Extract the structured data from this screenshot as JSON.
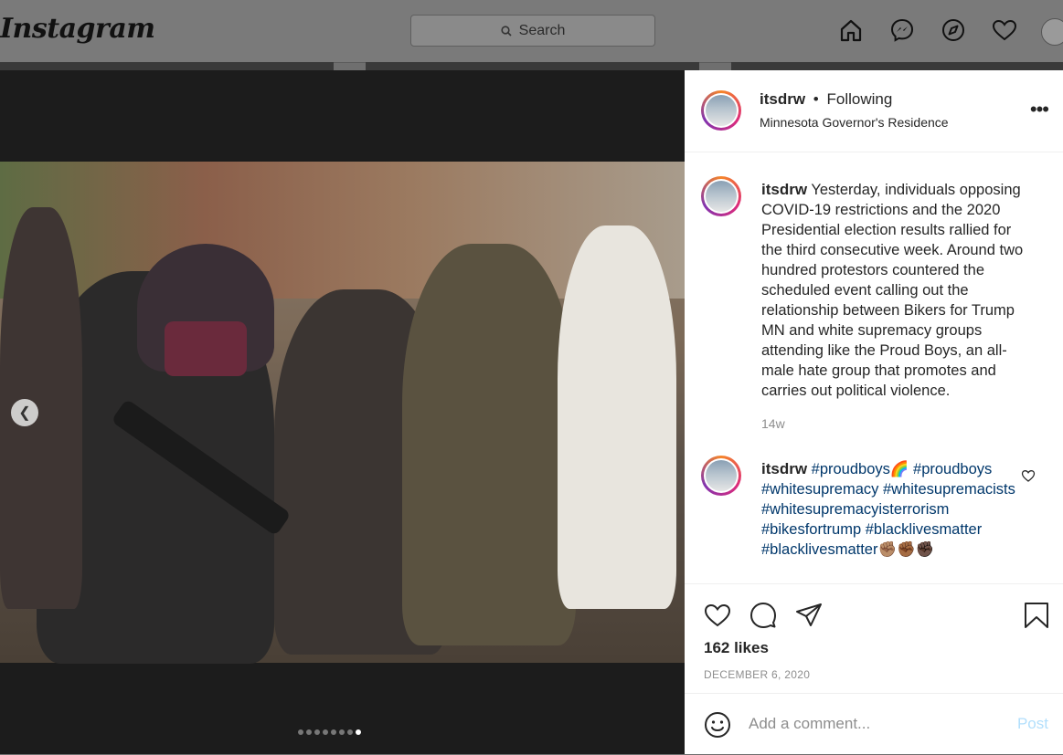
{
  "topnav": {
    "logo": "Instagram",
    "search_placeholder": "Search"
  },
  "post": {
    "username": "itsdrw",
    "separator": "•",
    "follow_status": "Following",
    "location": "Minnesota Governor's Residence",
    "caption": {
      "username": "itsdrw",
      "text": "Yesterday, individuals opposing COVID-19 restrictions and the 2020 Presidential election results rallied for the third consecutive week. Around two hundred protestors countered the scheduled event calling out the relationship between Bikers for Trump MN and white supremacy groups attending like the Proud Boys, an all-male hate group that promotes and carries out political violence.",
      "time": "14w"
    },
    "comment": {
      "username": "itsdrw",
      "tags": [
        "#proudboys",
        "#proudboys",
        "#whitesupremacy",
        "#whitesupremacists",
        "#whitesupremacyisterrorism",
        "#bikesfortrump",
        "#blacklivesmatter",
        "#blacklivesmatter"
      ],
      "emoji_rainbow": "🌈",
      "emoji_fists": "✊🏽✊🏾✊🏿"
    },
    "likes": "162 likes",
    "date": "DECEMBER 6, 2020",
    "add_comment_placeholder": "Add a comment...",
    "post_button": "Post",
    "carousel": {
      "total": 8,
      "active": 8
    }
  }
}
